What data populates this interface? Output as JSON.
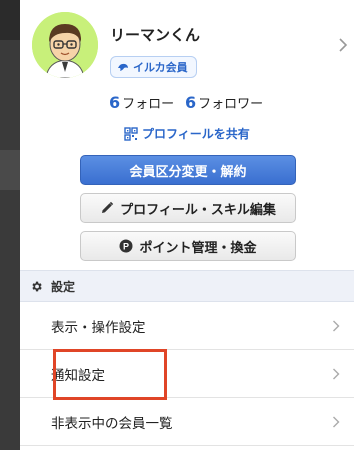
{
  "profile": {
    "name": "リーマンくん",
    "badge_label": "イルカ会員",
    "following_count": "6",
    "following_label": "フォロー",
    "followers_count": "6",
    "followers_label": "フォロワー",
    "share_label": "プロフィールを共有"
  },
  "buttons": {
    "membership": "会員区分変更・解約",
    "edit_profile": "プロフィール・スキル編集",
    "points": "ポイント管理・換金"
  },
  "settings": {
    "header": "設定",
    "items": [
      {
        "label": "表示・操作設定"
      },
      {
        "label": "通知設定"
      },
      {
        "label": "非表示中の会員一覧"
      }
    ]
  },
  "colors": {
    "accent": "#2a66c9",
    "primary_button": "#4a7fd9",
    "avatar_bg": "#c8f07a",
    "highlight": "#e04527",
    "section_bg": "#eef1f8"
  },
  "icons": {
    "badge": "dolphin-icon",
    "share": "qr-code-icon",
    "edit": "pencil-icon",
    "points": "point-coin-icon",
    "settings": "gear-icon",
    "chevron": "chevron-right-icon"
  }
}
